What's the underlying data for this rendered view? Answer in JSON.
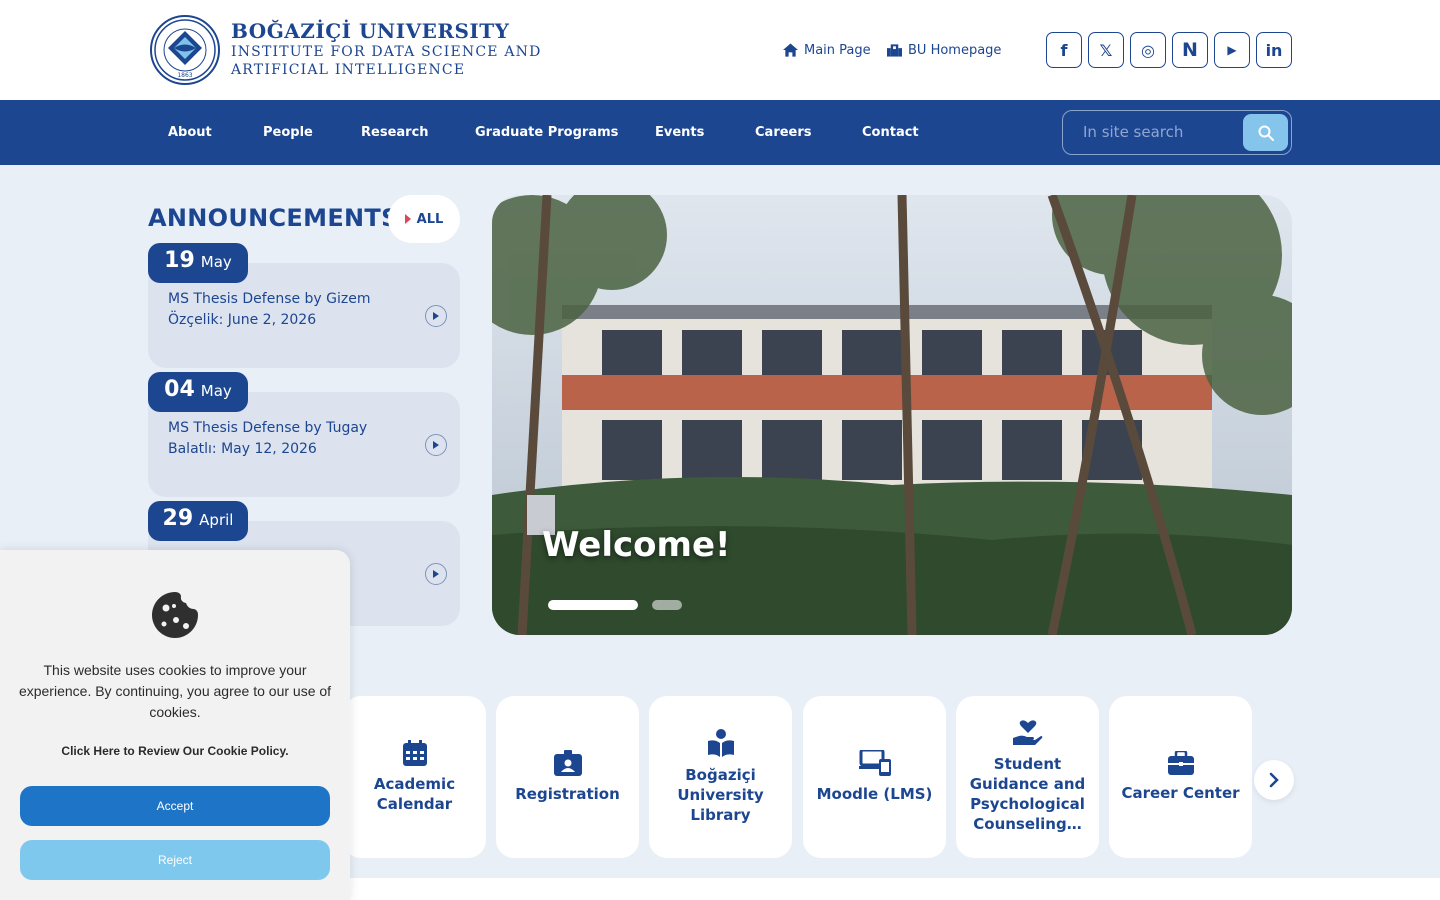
{
  "header": {
    "university": "BOĞAZİÇİ UNIVERSITY",
    "institute": "INSTITUTE FOR DATA SCIENCE AND ARTIFICIAL INTELLIGENCE",
    "logo_text": "BOĞAZİÇİ UNIVERSITY",
    "logo_year": "1863",
    "links": [
      {
        "label": "Main Page",
        "icon": "home-icon"
      },
      {
        "label": "BU Homepage",
        "icon": "building-icon"
      }
    ],
    "social": [
      {
        "label": "f",
        "icon": "facebook-icon"
      },
      {
        "label": "𝕏",
        "icon": "x-icon"
      },
      {
        "label": "◎",
        "icon": "instagram-icon"
      },
      {
        "label": "N",
        "icon": "nsosyal-icon"
      },
      {
        "label": "▶",
        "icon": "youtube-icon"
      },
      {
        "label": "in",
        "icon": "linkedin-icon"
      }
    ]
  },
  "nav": {
    "items": [
      "About",
      "People",
      "Research",
      "Graduate Programs",
      "Events",
      "Careers",
      "Contact"
    ],
    "search_placeholder": "In site search"
  },
  "announcements": {
    "title": "ANNOUNCEMENTS",
    "all_label": "ALL",
    "items": [
      {
        "day": "19",
        "month": "May",
        "text": "MS Thesis Defense by Gizem Özçelik: June 2, 2026"
      },
      {
        "day": "04",
        "month": "May",
        "text": "MS Thesis Defense by Tugay Balatlı: May 12, 2026"
      },
      {
        "day": "29",
        "month": "April",
        "text": ""
      }
    ]
  },
  "slider": {
    "caption": "Welcome!",
    "slides": 2,
    "active": 1
  },
  "quick_links": [
    {
      "label": "Academic Calendar",
      "icon": "calendar-icon"
    },
    {
      "label": "Registration",
      "icon": "id-badge-icon"
    },
    {
      "label": "Boğaziçi University Library",
      "icon": "book-reader-icon"
    },
    {
      "label": "Moodle (LMS)",
      "icon": "devices-icon"
    },
    {
      "label": "Student Guidance and Psychological Counseling…",
      "icon": "hand-heart-icon"
    },
    {
      "label": "Career Center",
      "icon": "briefcase-icon"
    }
  ],
  "cookie": {
    "text": "This website uses cookies to improve your experience. By continuing, you agree to our use of cookies.",
    "policy_link": "Click Here to Review Our Cookie Policy.",
    "accept": "Accept",
    "reject": "Reject"
  },
  "colors": {
    "primary": "#1d4691",
    "accent_light": "#85c5ec",
    "accept": "#1e74c6",
    "reject": "#7ec8ee",
    "page_bg": "#e9eff7"
  }
}
